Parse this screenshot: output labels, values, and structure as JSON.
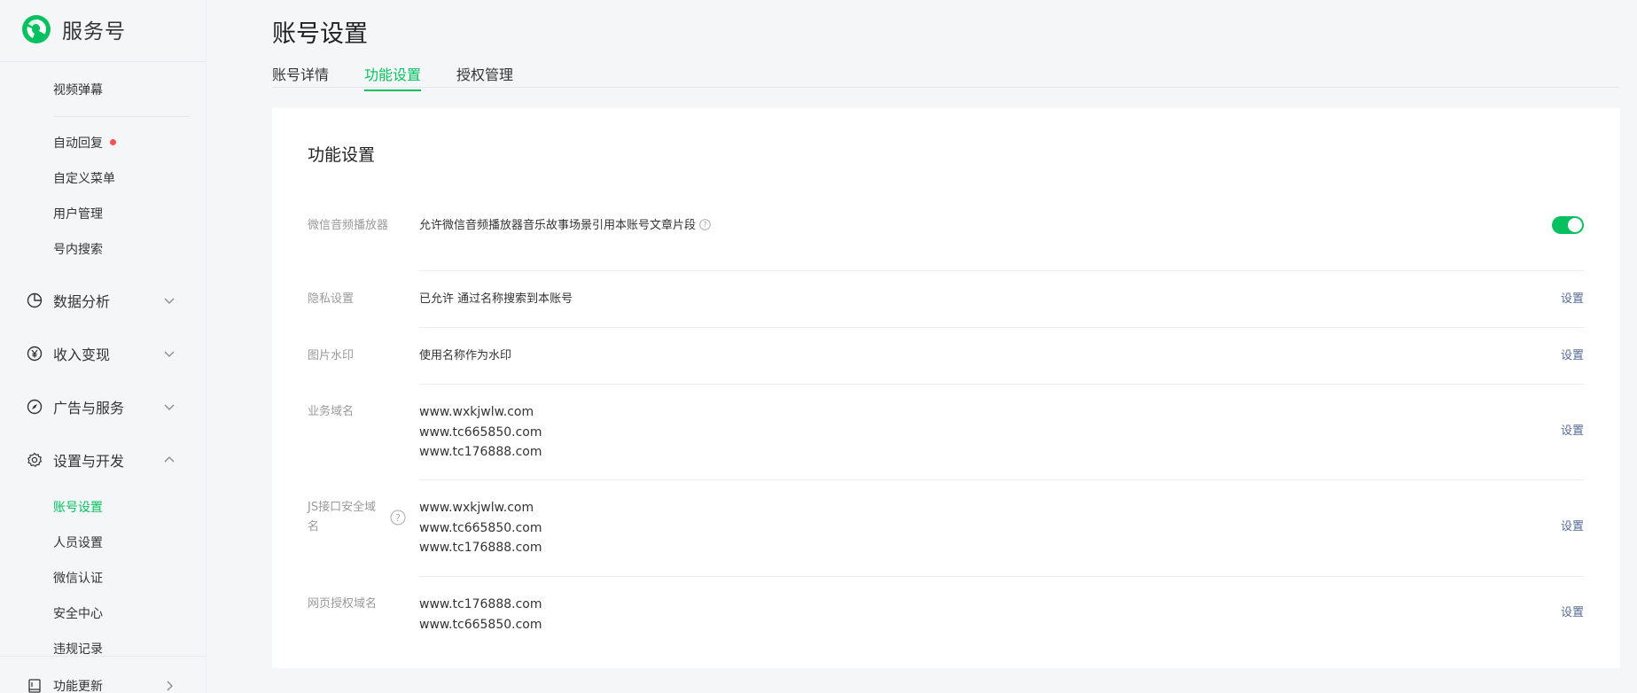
{
  "sidebar": {
    "app_name": "服务号",
    "items_top": [
      {
        "label": "视频弹幕"
      },
      {
        "label": "自动回复",
        "has_dot": true
      },
      {
        "label": "自定义菜单"
      },
      {
        "label": "用户管理"
      },
      {
        "label": "号内搜索"
      }
    ],
    "groups": [
      {
        "label": "数据分析",
        "icon": "pie-chart-icon",
        "expanded": false
      },
      {
        "label": "收入变现",
        "icon": "yen-coin-icon",
        "expanded": false
      },
      {
        "label": "广告与服务",
        "icon": "compass-icon",
        "expanded": false
      },
      {
        "label": "设置与开发",
        "icon": "gear-icon",
        "expanded": true
      }
    ],
    "settings_items": [
      {
        "label": "账号设置",
        "active": true
      },
      {
        "label": "人员设置"
      },
      {
        "label": "微信认证"
      },
      {
        "label": "安全中心"
      },
      {
        "label": "违规记录"
      }
    ],
    "bottom_item": {
      "label": "功能更新",
      "icon": "book-icon"
    }
  },
  "page": {
    "title": "账号设置",
    "tabs": [
      {
        "label": "账号详情"
      },
      {
        "label": "功能设置",
        "active": true
      },
      {
        "label": "授权管理"
      }
    ]
  },
  "card": {
    "title": "功能设置",
    "rows": {
      "audio": {
        "label": "微信音频播放器",
        "text": "允许微信音频播放器音乐故事场景引用本账号文章片段",
        "toggle_on": true
      },
      "privacy": {
        "label": "隐私设置",
        "text": "已允许 通过名称搜索到本账号",
        "action": "设置"
      },
      "watermark": {
        "label": "图片水印",
        "text": "使用名称作为水印",
        "action": "设置"
      },
      "business_domain": {
        "label": "业务域名",
        "domains": [
          "www.wxkjwlw.com",
          "www.tc665850.com",
          "www.tc176888.com"
        ],
        "action": "设置"
      },
      "js_domain": {
        "label_line1": "JS接口安全域",
        "label_line2": "名",
        "domains": [
          "www.wxkjwlw.com",
          "www.tc665850.com",
          "www.tc176888.com"
        ],
        "action": "设置"
      },
      "oauth_domain": {
        "label": "网页授权域名",
        "domains": [
          "www.tc176888.com",
          "www.tc665850.com"
        ],
        "action": "设置"
      }
    }
  },
  "colors": {
    "accent": "#07c160",
    "link": "#576b95",
    "badge": "#fa5151"
  }
}
